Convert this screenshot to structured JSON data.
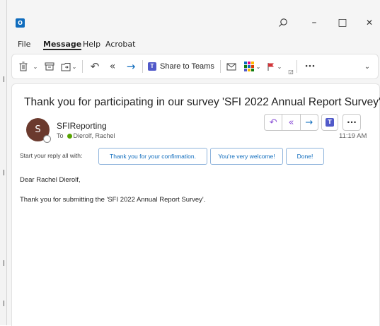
{
  "menu": {
    "file": "File",
    "message": "Message",
    "help": "Help",
    "acrobat": "Acrobat"
  },
  "window": {
    "logo_letter": "O",
    "search_icon": "search-icon",
    "minimize": "–",
    "maximize": "□",
    "close": "✕"
  },
  "ribbon": {
    "share_to_teams": "Share to Teams",
    "more": "···"
  },
  "email": {
    "subject": "Thank you for participating in our survey 'SFI 2022 Annual Report Survey'",
    "avatar_letter": "S",
    "sender": "SFIReporting",
    "to_label": "To",
    "recipient": "Dierolf, Rachel",
    "time": "11:19 AM",
    "more": "···"
  },
  "quick_reply": {
    "label": "Start your reply all with:",
    "options": [
      "Thank you for your confirmation.",
      "You're very welcome!",
      "Done!"
    ]
  },
  "body": {
    "greeting": "Dear Rachel Dierolf,",
    "line1": "Thank you for submitting the 'SFI 2022 Annual Report Survey'."
  },
  "colors": {
    "accent": "#0f6cbd",
    "reply_purple": "#8a4fd6",
    "avatar": "#6b3a2e",
    "presence_green": "#57a300"
  }
}
